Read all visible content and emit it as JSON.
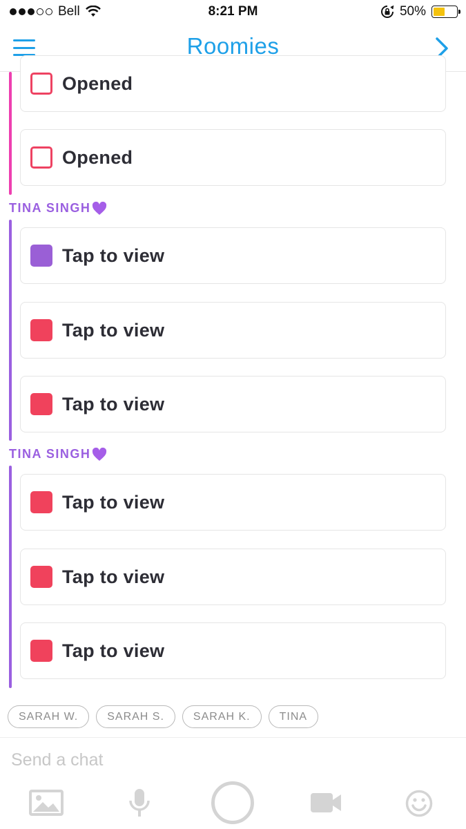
{
  "status_bar": {
    "carrier": "Bell",
    "time": "8:21 PM",
    "battery": "50%",
    "battery_level": 0.5,
    "battery_color": "#f4c20d"
  },
  "header": {
    "title": "Roomies",
    "accent_color": "#1ea0e8",
    "left_icon": "menu-icon",
    "right_icon": "chevron-right-icon"
  },
  "groups": [
    {
      "sender": "",
      "thread_color": "#ee3fb0",
      "messages": [
        {
          "label": "Opened",
          "status": "opened",
          "color": "#ee4262"
        },
        {
          "label": "Opened",
          "status": "opened",
          "color": "#ee4262"
        }
      ]
    },
    {
      "sender": "TINA SINGH",
      "emoji": "purple-heart-icon",
      "thread_color": "#9a5fe0",
      "messages": [
        {
          "label": "Tap to view",
          "status": "unopened",
          "color": "#9a5fd6"
        },
        {
          "label": "Tap to view",
          "status": "unopened",
          "color": "#f0425c"
        },
        {
          "label": "Tap to view",
          "status": "unopened",
          "color": "#f0425c"
        }
      ]
    },
    {
      "sender": "TINA SINGH",
      "emoji": "purple-heart-icon",
      "thread_color": "#9a5fe0",
      "messages": [
        {
          "label": "Tap to view",
          "status": "unopened",
          "color": "#f0425c"
        },
        {
          "label": "Tap to view",
          "status": "unopened",
          "color": "#f0425c"
        },
        {
          "label": "Tap to view",
          "status": "unopened",
          "color": "#f0425c"
        }
      ]
    }
  ],
  "chips": [
    "SARAH W.",
    "SARAH S.",
    "SARAH K.",
    "TINA"
  ],
  "chat_input": {
    "placeholder": "Send a chat",
    "value": ""
  },
  "toolbar": [
    "gallery-icon",
    "microphone-icon",
    "capture-button",
    "video-camera-icon",
    "smiley-icon"
  ]
}
